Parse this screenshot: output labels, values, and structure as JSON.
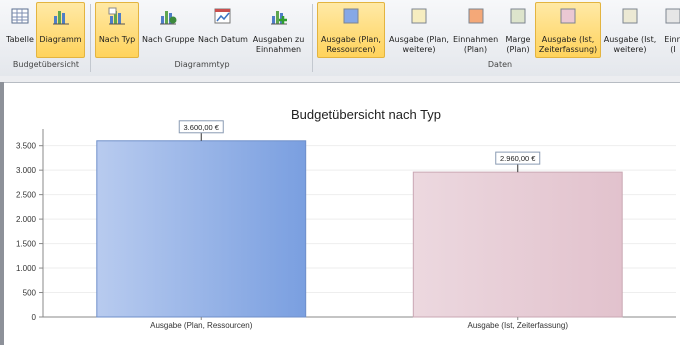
{
  "ribbon": {
    "groups": [
      {
        "label": "Budgetübersicht",
        "buttons": [
          {
            "label": "Tabelle",
            "icon": "table-icon",
            "active": false
          },
          {
            "label": "Diagramm",
            "icon": "chart-icon",
            "active": true
          }
        ]
      },
      {
        "label": "Diagrammtyp",
        "buttons": [
          {
            "label": "Nach Typ",
            "icon": "chart-by-type-icon",
            "active": true
          },
          {
            "label": "Nach Gruppe",
            "icon": "chart-by-group-icon",
            "active": false
          },
          {
            "label": "Nach Datum",
            "icon": "calendar-chart-icon",
            "active": false
          },
          {
            "label": "Ausgaben zu\nEinnahmen",
            "icon": "chart-add-icon",
            "active": false
          }
        ]
      },
      {
        "label": "Daten",
        "buttons": [
          {
            "label": "Ausgabe (Plan,\nRessourcen)",
            "icon": "blue-swatch-icon",
            "color": "#86a8e6",
            "active": true
          },
          {
            "label": "Ausgabe (Plan,\nweitere)",
            "icon": "yellow-swatch-icon",
            "color": "#f6edc0",
            "active": false
          },
          {
            "label": "Einnahmen\n(Plan)",
            "icon": "orange-swatch-icon",
            "color": "#f4a878",
            "active": false
          },
          {
            "label": "Marge\n(Plan)",
            "icon": "green-swatch-icon",
            "color": "#dde4cc",
            "active": false
          },
          {
            "label": "Ausgabe (Ist,\nZeiterfassung)",
            "icon": "pink-swatch-icon",
            "color": "#ebc8d3",
            "active": true
          },
          {
            "label": "Ausgabe (Ist,\nweitere)",
            "icon": "beige-swatch-icon",
            "color": "#ece9d4",
            "active": false
          },
          {
            "label": "Einn\n(I",
            "icon": "swatch-icon",
            "color": "#e6e6e6",
            "active": false
          }
        ]
      }
    ]
  },
  "chart_data": {
    "type": "bar",
    "title": "Budgetübersicht nach Typ",
    "categories": [
      "Ausgabe (Plan, Ressourcen)",
      "Ausgabe (Ist, Zeiterfassung)"
    ],
    "values": [
      3600,
      2960
    ],
    "value_labels": [
      "3.600,00 €",
      "2.960,00 €"
    ],
    "colors": [
      "#86a8e6",
      "#ebc8d3"
    ],
    "ylim": [
      0,
      3800
    ],
    "yticks": [
      0,
      500,
      1000,
      1500,
      2000,
      2500,
      3000,
      3500
    ],
    "ytick_labels": [
      "0",
      "500",
      "1.000",
      "1.500",
      "2.000",
      "2.500",
      "3.000",
      "3.500"
    ],
    "grid": true,
    "xlabel": "",
    "ylabel": ""
  }
}
